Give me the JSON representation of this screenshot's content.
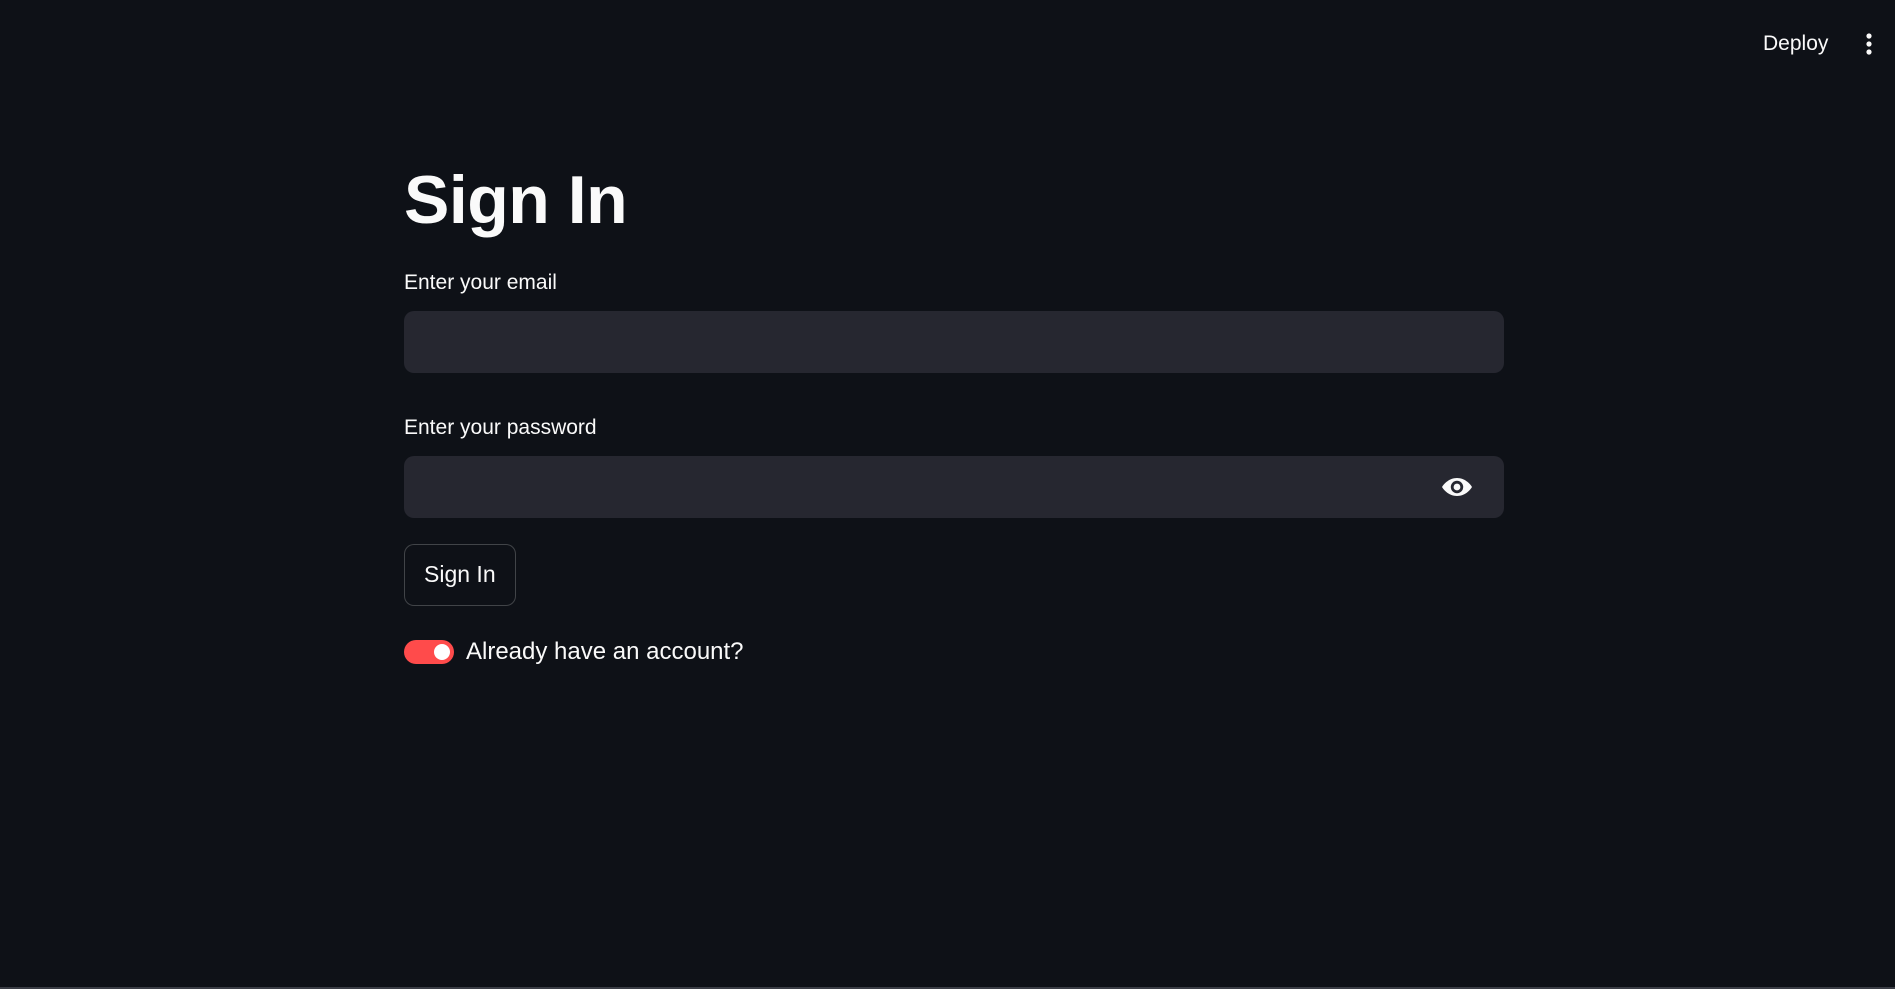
{
  "header": {
    "deploy_label": "Deploy",
    "menu_icon": "kebab-menu-icon"
  },
  "form": {
    "title": "Sign In",
    "email": {
      "label": "Enter your email",
      "value": "",
      "placeholder": ""
    },
    "password": {
      "label": "Enter your password",
      "value": "",
      "placeholder": "",
      "toggle_icon": "eye-icon"
    },
    "submit_label": "Sign In",
    "account_toggle": {
      "label": "Already have an account?",
      "checked": true
    }
  },
  "colors": {
    "background": "#0e1117",
    "input_background": "#262730",
    "accent": "#ff4b4b",
    "text": "#fafafa"
  }
}
